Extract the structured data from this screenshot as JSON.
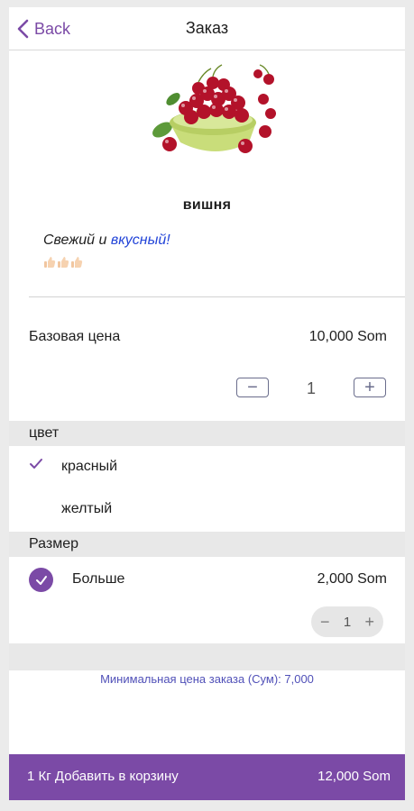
{
  "nav": {
    "back_label": "Back",
    "title": "Заказ"
  },
  "product": {
    "name": "вишня",
    "description_plain": "Свежий и ",
    "description_highlight": "вкусный!",
    "emoji": [
      "thumbs-up-icon",
      "thumbs-up-icon",
      "thumbs-up-icon"
    ]
  },
  "pricing": {
    "base_label": "Базовая цена",
    "base_value": "10,000 Som"
  },
  "quantity": {
    "minus": "−",
    "value": "1",
    "plus": "+"
  },
  "color_section": {
    "title": "цвет",
    "options": [
      {
        "label": "красный",
        "selected": true
      },
      {
        "label": "желтый",
        "selected": false
      }
    ]
  },
  "size_section": {
    "title": "Размер",
    "option": {
      "label": "Больше",
      "price": "2,000 Som",
      "selected": true
    },
    "qty": {
      "minus": "−",
      "value": "1",
      "plus": "+"
    }
  },
  "min_order_note": "Минимальная цена заказа (Сум): 7,000",
  "footer": {
    "left_label": "1 Кг Добавить в корзину",
    "total": "12,000 Som"
  },
  "colors": {
    "accent": "#7b4aa6",
    "highlight_text": "#2244d8",
    "note_text": "#5050b8"
  }
}
